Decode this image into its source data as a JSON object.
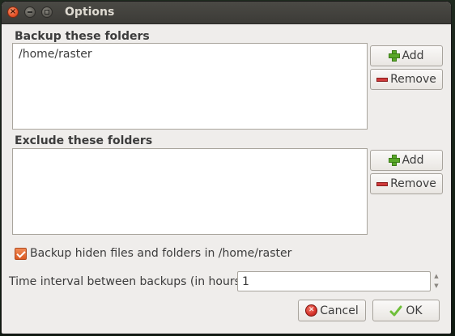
{
  "window": {
    "title": "Options",
    "close_glyph": "×"
  },
  "backup": {
    "label": "Backup these folders",
    "items": [
      "/home/raster"
    ],
    "add_label": "Add",
    "remove_label": "Remove"
  },
  "exclude": {
    "label": "Exclude these folders",
    "items": [],
    "add_label": "Add",
    "remove_label": "Remove"
  },
  "hidden_files": {
    "label": "Backup hiden files and folders in /home/raster",
    "checked": true
  },
  "interval": {
    "label": "Time interval between backups (in hours):",
    "value": "1"
  },
  "footer": {
    "cancel_label": "Cancel",
    "ok_label": "OK"
  },
  "colors": {
    "accent": "#dd5a22",
    "titlebar": "#3c3b37",
    "add_icon": "#5aa829",
    "remove_icon": "#cf3a3a",
    "ok_icon": "#6fbf3a"
  },
  "icons": {
    "close": "close-icon",
    "minimize": "minimize-icon",
    "maximize": "maximize-icon",
    "add": "plus-icon",
    "remove": "minus-icon",
    "cancel": "cancel-icon",
    "ok": "checkmark-icon"
  }
}
